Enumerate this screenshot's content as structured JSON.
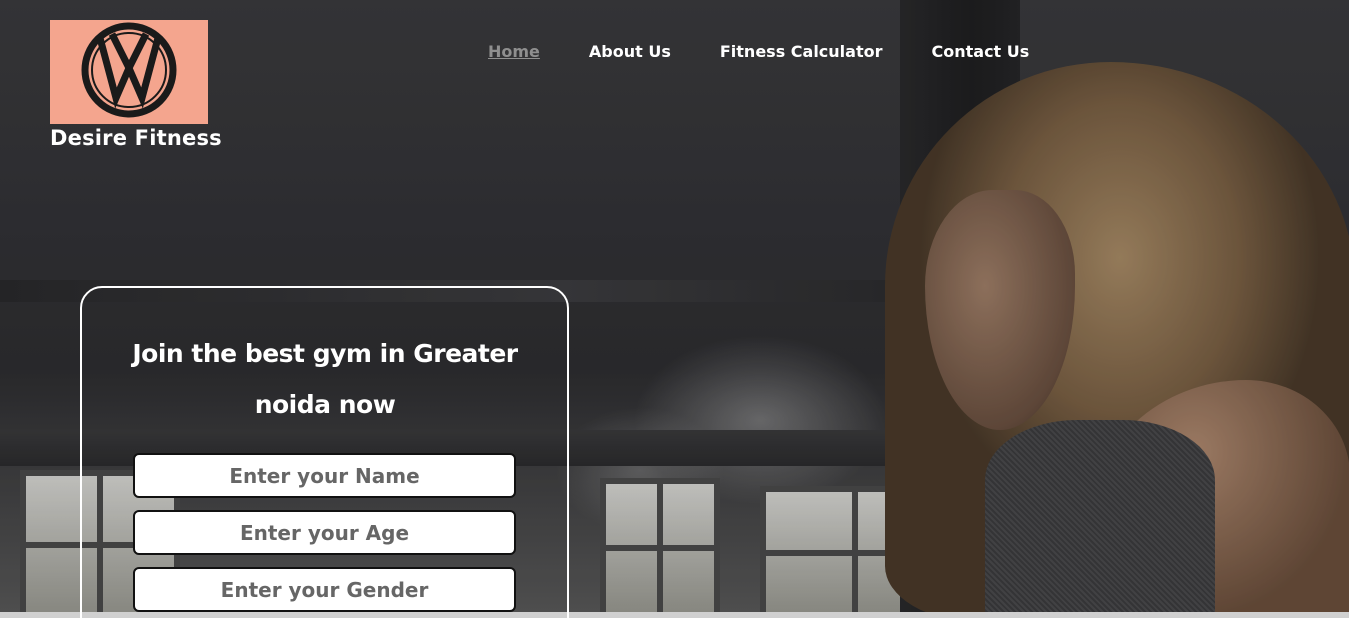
{
  "brand": {
    "name": "Desire Fitness",
    "logo_icon": "vw-emblem-icon",
    "logo_bg": "#f4a58e"
  },
  "nav": {
    "items": [
      {
        "label": "Home",
        "active": true
      },
      {
        "label": "About Us",
        "active": false
      },
      {
        "label": "Fitness Calculator",
        "active": false
      },
      {
        "label": "Contact Us",
        "active": false
      }
    ]
  },
  "join": {
    "title": "Join the best gym in Greater noida now",
    "fields": {
      "name_placeholder": "Enter your Name",
      "age_placeholder": "Enter your Age",
      "gender_placeholder": "Enter your Gender"
    }
  },
  "colors": {
    "nav_text": "#ffffff",
    "nav_active": "#8f8f8f",
    "card_border": "#ffffff"
  }
}
